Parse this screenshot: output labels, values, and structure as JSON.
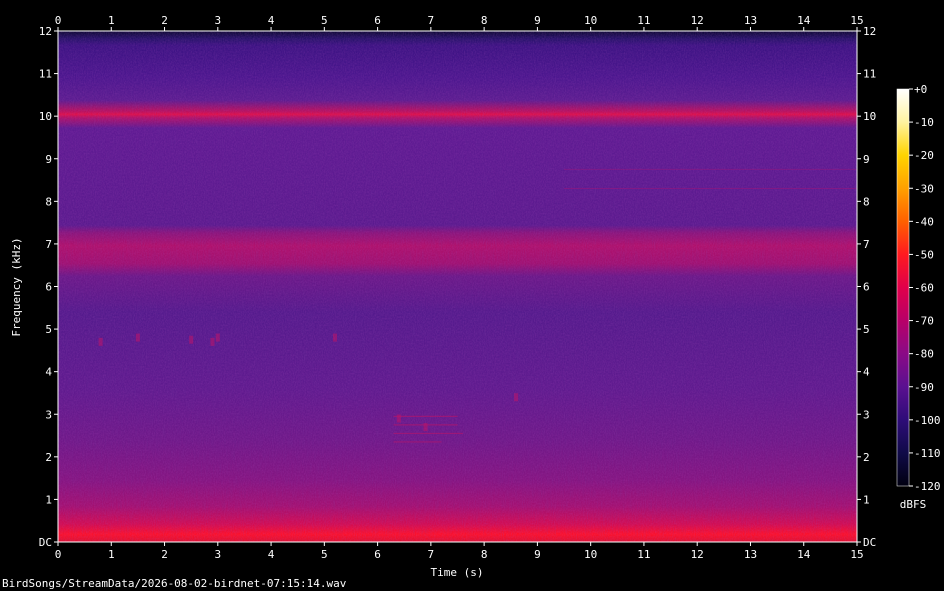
{
  "window": {
    "file_label": "BirdSongs/StreamData/2026-08-02-birdnet-07:15:14.wav"
  },
  "chart_data": {
    "type": "heatmap",
    "xlabel": "Time (s)",
    "ylabel": "Frequency (kHz)",
    "xlim": [
      0,
      15
    ],
    "ylim": [
      0,
      12
    ],
    "x_ticks": [
      "0",
      "1",
      "2",
      "3",
      "4",
      "5",
      "6",
      "7",
      "8",
      "9",
      "10",
      "11",
      "12",
      "13",
      "14",
      "15"
    ],
    "y_ticks": [
      "DC",
      "1",
      "2",
      "3",
      "4",
      "5",
      "6",
      "7",
      "8",
      "9",
      "10",
      "11",
      "12"
    ],
    "colorbar": {
      "unit": "dBFS",
      "range": [
        -120,
        0
      ],
      "ticks": [
        "+0",
        "-10",
        "-20",
        "-30",
        "-40",
        "-50",
        "-60",
        "-70",
        "-80",
        "-90",
        "-100",
        "-110",
        "-120"
      ],
      "colors": [
        "#ffffff",
        "#fff3a0",
        "#ffd400",
        "#ffa000",
        "#ff6000",
        "#ff1a20",
        "#e0004a",
        "#b80068",
        "#8a0a86",
        "#5a1090",
        "#2e0c78",
        "#100a48",
        "#000010"
      ]
    },
    "bands": [
      {
        "freq_khz": 0.1,
        "level_dbfs": -45
      },
      {
        "freq_khz": 0.5,
        "level_dbfs": -60
      },
      {
        "freq_khz": 6.7,
        "level_dbfs": -60
      },
      {
        "freq_khz": 10.0,
        "level_dbfs": -50
      },
      {
        "freq_khz": 11.7,
        "level_dbfs": -105
      }
    ],
    "background_level_dbfs": -80
  }
}
